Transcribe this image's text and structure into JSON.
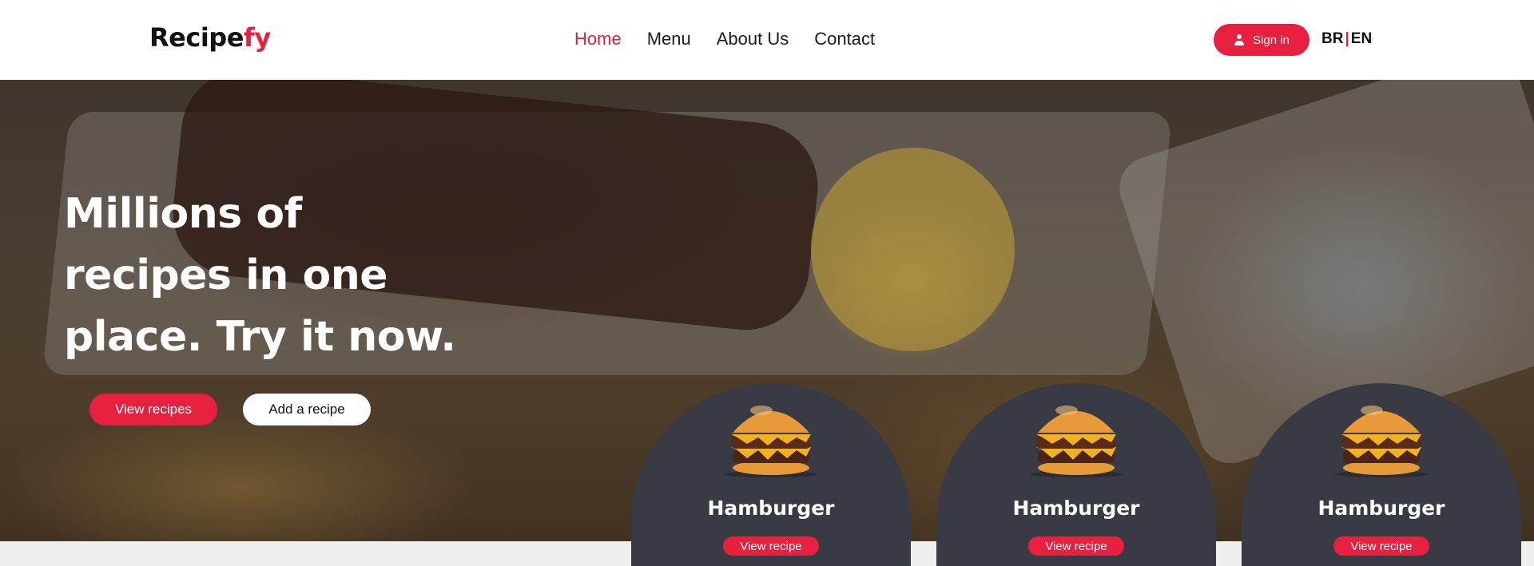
{
  "header": {
    "logo": {
      "part1": "Recipe",
      "part2": "fy"
    },
    "nav": [
      {
        "label": "Home",
        "active": true
      },
      {
        "label": "Menu",
        "active": false
      },
      {
        "label": "About Us",
        "active": false
      },
      {
        "label": "Contact",
        "active": false
      }
    ],
    "signin_label": "Sign in",
    "signin_icon": "user-icon",
    "lang": {
      "br": "BR",
      "separator": "|",
      "en": "EN"
    }
  },
  "hero": {
    "title": "Millions of recipes in one place. Try it now.",
    "primary_button": "View recipes",
    "secondary_button": "Add a recipe"
  },
  "cards": [
    {
      "name": "Hamburger",
      "button": "View recipe"
    },
    {
      "name": "Hamburger",
      "button": "View recipe"
    },
    {
      "name": "Hamburger",
      "button": "View recipe"
    }
  ],
  "colors": {
    "accent": "#e8203f",
    "card_bg": "#383b44",
    "header_bg": "#ffffff",
    "page_bg": "#efefef"
  }
}
